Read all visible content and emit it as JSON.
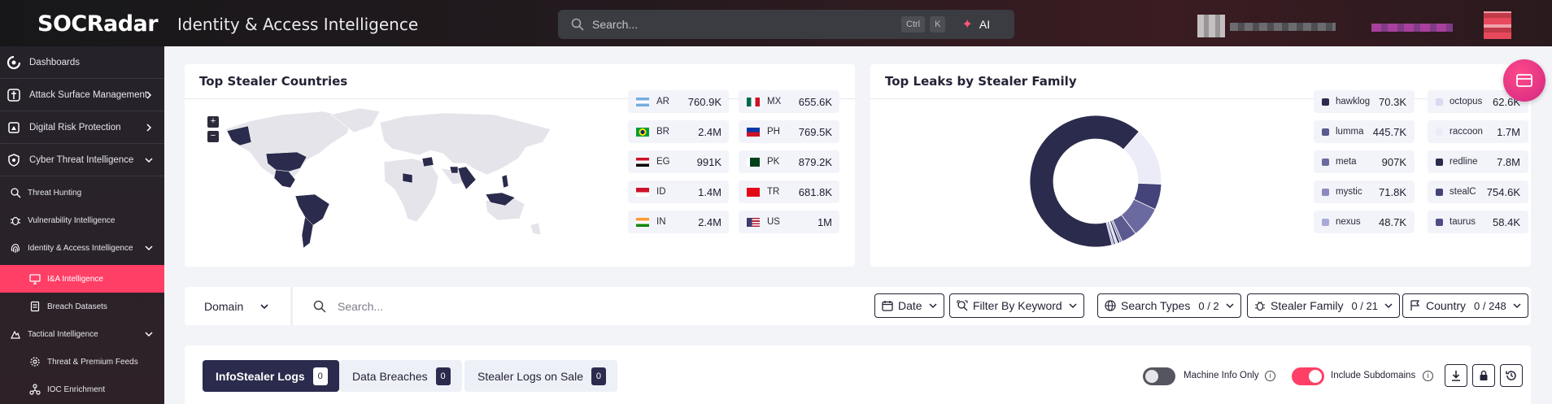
{
  "header": {
    "logo": "SOCRadar",
    "title": "Identity & Access Intelligence",
    "search_placeholder": "Search...",
    "kbd_ctrl": "Ctrl",
    "kbd_k": "K",
    "ai_label": "AI"
  },
  "sidebar": {
    "items": [
      {
        "label": "Dashboards",
        "icon": "dashboard-icon"
      },
      {
        "label": "Attack Surface Management",
        "icon": "asm-icon"
      },
      {
        "label": "Digital Risk Protection",
        "icon": "drp-icon"
      },
      {
        "label": "Cyber Threat Intelligence",
        "icon": "cti-icon"
      },
      {
        "label": "Threat Hunting",
        "icon": "search-icon"
      },
      {
        "label": "Vulnerability Intelligence",
        "icon": "bug-icon"
      },
      {
        "label": "Identity & Access Intelligence",
        "icon": "fingerprint-icon"
      },
      {
        "label": "I&A Intelligence",
        "icon": "monitor-icon"
      },
      {
        "label": "Breach Datasets",
        "icon": "database-icon"
      },
      {
        "label": "Tactical Intelligence",
        "icon": "tactical-icon"
      },
      {
        "label": "Threat & Premium Feeds",
        "icon": "feed-icon"
      },
      {
        "label": "IOC Enrichment",
        "icon": "enrichment-icon"
      }
    ]
  },
  "countries_card": {
    "title": "Top Stealer Countries",
    "zoom_in": "+",
    "zoom_out": "−",
    "items": [
      {
        "code": "AR",
        "value": "760.9K"
      },
      {
        "code": "MX",
        "value": "655.6K"
      },
      {
        "code": "BR",
        "value": "2.4M"
      },
      {
        "code": "PH",
        "value": "769.5K"
      },
      {
        "code": "EG",
        "value": "991K"
      },
      {
        "code": "PK",
        "value": "879.2K"
      },
      {
        "code": "ID",
        "value": "1.4M"
      },
      {
        "code": "TR",
        "value": "681.8K"
      },
      {
        "code": "IN",
        "value": "2.4M"
      },
      {
        "code": "US",
        "value": "1M"
      }
    ]
  },
  "families_card": {
    "title": "Top Leaks by Stealer Family",
    "items": [
      {
        "name": "hawklog",
        "value": "70.3K",
        "color": "#2b2b4d"
      },
      {
        "name": "octopus",
        "value": "62.6K",
        "color": "#d9d9f2"
      },
      {
        "name": "lumma",
        "value": "445.7K",
        "color": "#5a5a8e"
      },
      {
        "name": "raccoon",
        "value": "1.7M",
        "color": "#ececf8"
      },
      {
        "name": "meta",
        "value": "907K",
        "color": "#6a6aa0"
      },
      {
        "name": "redline",
        "value": "7.8M",
        "color": "#2b2b4d"
      },
      {
        "name": "mystic",
        "value": "71.8K",
        "color": "#8a8ac0"
      },
      {
        "name": "stealC",
        "value": "754.6K",
        "color": "#44447a"
      },
      {
        "name": "nexus",
        "value": "48.7K",
        "color": "#a9a9d8"
      },
      {
        "name": "taurus",
        "value": "58.4K",
        "color": "#4e4e84"
      }
    ]
  },
  "filters": {
    "domain_label": "Domain",
    "search_placeholder": "Search...",
    "date_label": "Date",
    "keyword_label": "Filter By Keyword",
    "search_types_label": "Search Types",
    "search_types_count": "0 / 2",
    "stealer_family_label": "Stealer Family",
    "stealer_family_count": "0 / 21",
    "country_label": "Country",
    "country_count": "0 / 248"
  },
  "tabs": [
    {
      "label": "InfoStealer Logs",
      "count": "0"
    },
    {
      "label": "Data Breaches",
      "count": "0"
    },
    {
      "label": "Stealer Logs on Sale",
      "count": "0"
    }
  ],
  "toggles": {
    "machine_info_label": "Machine Info Only",
    "machine_info_on": false,
    "subdomains_label": "Include Subdomains",
    "subdomains_on": true,
    "info_glyph": "i"
  }
}
